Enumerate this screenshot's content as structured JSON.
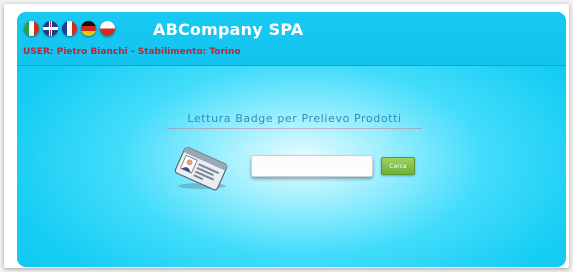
{
  "header": {
    "app_title": "ABCompany SPA",
    "user_line": "USER: Pietro Bianchi - Stabilimento: Torino",
    "flags": [
      {
        "icon": "italian-flag-icon",
        "colors": [
          "#2ea043",
          "#ffffff",
          "#d52b1e"
        ]
      },
      {
        "icon": "uk-flag-icon",
        "colors": [
          "#1d3c8c",
          "#ffffff",
          "#cc1f2f"
        ]
      },
      {
        "icon": "french-flag-icon",
        "colors": [
          "#1e3f99",
          "#ffffff",
          "#d52b1e"
        ]
      },
      {
        "icon": "german-flag-icon",
        "colors": [
          "#111111",
          "#d52b1e",
          "#f5c400"
        ]
      },
      {
        "icon": "polish-flag-icon",
        "colors": [
          "#ffffff",
          "#d52b1e"
        ]
      }
    ]
  },
  "main": {
    "section_title": "Lettura Badge per Prelievo Prodotti",
    "badge_icon": "id-badge-icon",
    "badge_input": {
      "value": "",
      "placeholder": ""
    },
    "search_button_label": "Cerca"
  },
  "colors": {
    "panel": "#12c4ee",
    "user_text": "#b3263a",
    "section_title": "#2f8fb6",
    "button": "#7bbf45"
  }
}
